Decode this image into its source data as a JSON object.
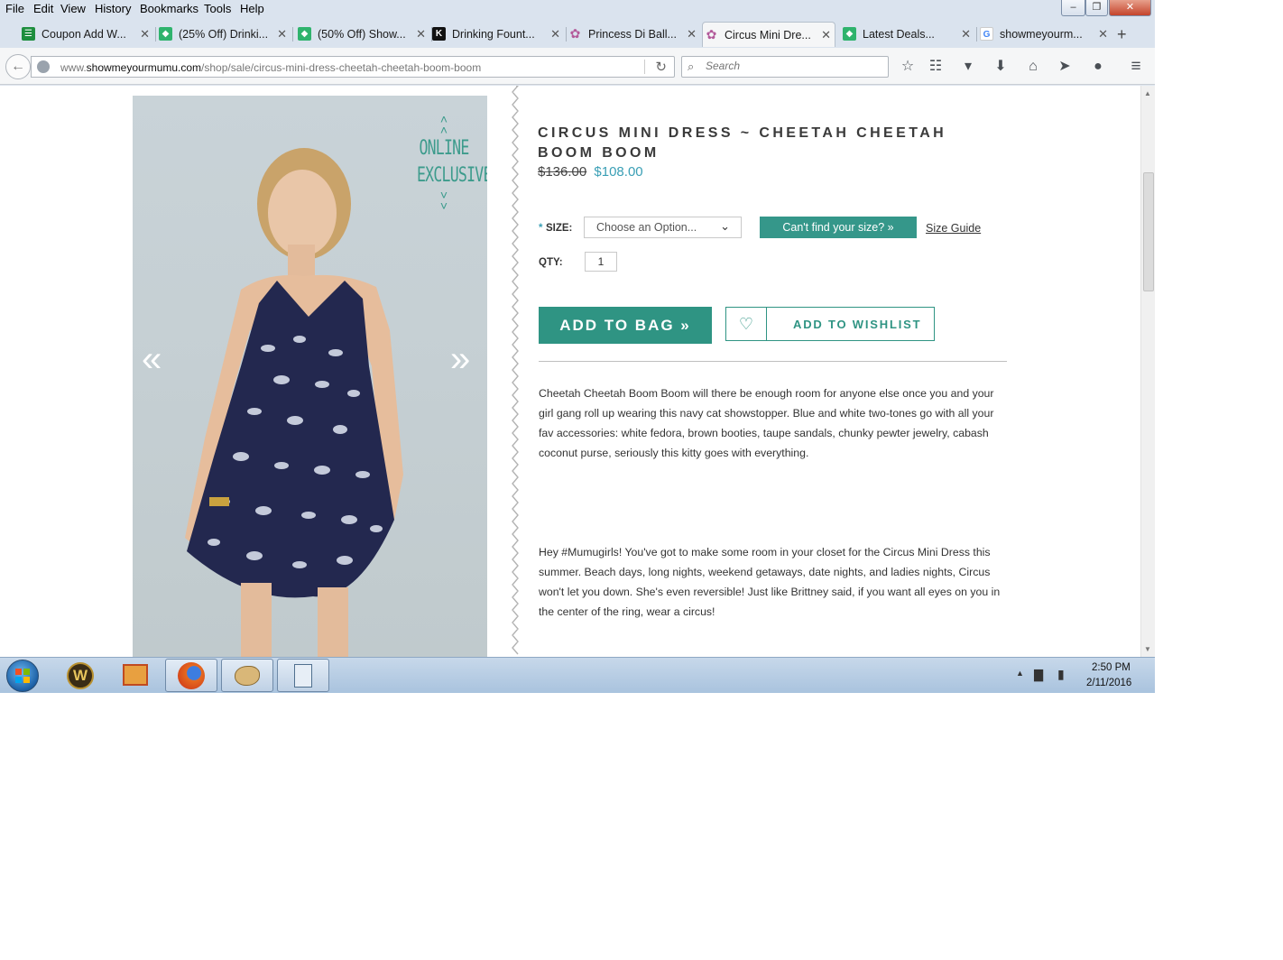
{
  "menu": [
    "File",
    "Edit",
    "View",
    "History",
    "Bookmarks",
    "Tools",
    "Help"
  ],
  "window_controls": {
    "minimize": "–",
    "restore": "❐",
    "close": "✕"
  },
  "tabs": [
    {
      "title": "Coupon Add W...",
      "favicon": "spreadsheet-icon",
      "color": "#1e8e3e",
      "glyph": "☰"
    },
    {
      "title": "(25% Off) Drinki...",
      "favicon": "tag-icon",
      "color": "#2fb36d",
      "glyph": "◆"
    },
    {
      "title": "(50% Off) Show...",
      "favicon": "tag-icon",
      "color": "#2fb36d",
      "glyph": "◆"
    },
    {
      "title": "Drinking Fount...",
      "favicon": "k-icon",
      "color": "#111111",
      "glyph": "K"
    },
    {
      "title": "Princess Di Ball...",
      "favicon": "flower-icon",
      "color": "#b35a9a",
      "glyph": "✿"
    },
    {
      "title": "Circus Mini Dre...",
      "favicon": "flower-icon",
      "color": "#b35a9a",
      "glyph": "✿"
    },
    {
      "title": "Latest Deals...",
      "favicon": "tag-icon",
      "color": "#2fb36d",
      "glyph": "◆"
    },
    {
      "title": "showmeyourm...",
      "favicon": "google-icon",
      "color": "#4285f4",
      "glyph": "G"
    }
  ],
  "active_tab": 5,
  "url": {
    "prefix": "www.",
    "domain": "showmeyourmumu.com",
    "path": "/shop/sale/circus-mini-dress-cheetah-cheetah-boom-boom"
  },
  "search": {
    "placeholder": "Search"
  },
  "product": {
    "title": "CIRCUS MINI DRESS ~ CHEETAH CHEETAH BOOM BOOM",
    "price_original": "$136.00",
    "price_sale": "$108.00",
    "badge_text_1": "ONLINE",
    "badge_text_2": "EXCLUSIVE",
    "size_required_mark": "*",
    "size_label": "SIZE:",
    "size_placeholder": "Choose an Option...",
    "cant_find_label": "Can't find your size? »",
    "size_guide": "Size Guide",
    "qty_label": "QTY:",
    "qty_value": "1",
    "add_to_bag": "ADD TO BAG »",
    "add_to_wishlist": "ADD TO WISHLIST",
    "description_1": "Cheetah Cheetah Boom Boom will there be enough room for anyone else once you and your girl gang roll up wearing this navy cat showstopper. Blue and white two-tones go with all your fav accessories: white fedora, brown booties, taupe sandals, chunky pewter jewelry, cabash coconut purse, seriously this kitty goes with everything.",
    "description_2": "Hey #Mumugirls! You've got to make some room in your closet for the Circus Mini Dress this summer. Beach days, long nights, weekend getaways, date nights, and ladies nights, Circus won't let you down. She's even reversible! Just like Brittney said, if you want all eyes on you in the center of the ring, wear a circus!"
  },
  "colors": {
    "accent": "#2f9483",
    "sale_price": "#3a9fb5",
    "dress_navy": "#23284f"
  },
  "clock": {
    "time": "2:50 PM",
    "date": "2/11/2016"
  }
}
